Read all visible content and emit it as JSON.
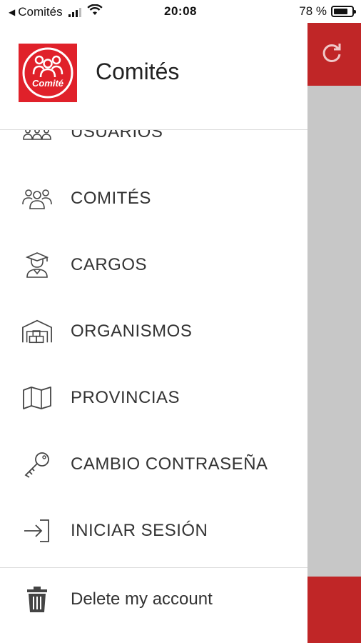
{
  "status_bar": {
    "back_app": "Comités",
    "time": "20:08",
    "battery": "78 %",
    "battery_level": 0.78
  },
  "drawer": {
    "logo_text": "Comité",
    "title": "Comités",
    "menu": [
      {
        "label": "USUARIOS",
        "icon": "users-board-icon"
      },
      {
        "label": "COMITÉS",
        "icon": "group-icon"
      },
      {
        "label": "CARGOS",
        "icon": "graduate-icon"
      },
      {
        "label": "ORGANISMOS",
        "icon": "building-icon"
      },
      {
        "label": "PROVINCIAS",
        "icon": "map-icon"
      },
      {
        "label": "CAMBIO CONTRASEÑA",
        "icon": "key-icon"
      },
      {
        "label": "INICIAR SESIÓN",
        "icon": "login-icon"
      }
    ],
    "footer": {
      "label": "Delete my account",
      "icon": "trash-icon"
    }
  },
  "background": {
    "icon": "refresh-icon",
    "accent": "#c02627"
  }
}
